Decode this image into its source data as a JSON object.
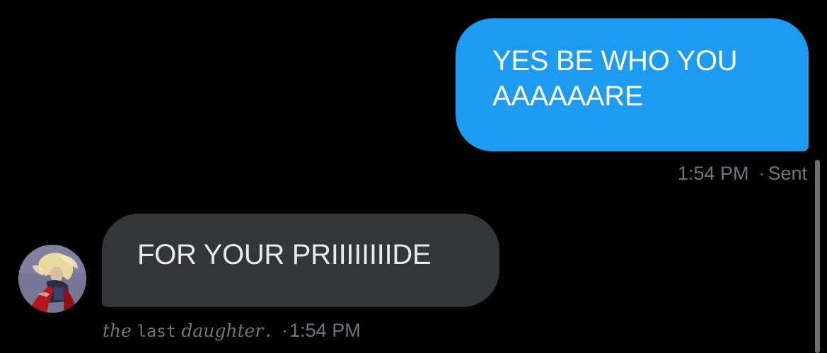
{
  "conversation": {
    "sent_message": {
      "text_line1": "YES BE WHO YOU",
      "text_line2": "AAAAAARE",
      "time": "1:54 PM",
      "separator": "·",
      "status": "Sent"
    },
    "received_message": {
      "text": "FOR YOUR PRIIIIIIIIDE",
      "sender_name": {
        "part1": "the",
        "part2": "last",
        "part3": "daughter",
        "part4": "."
      },
      "separator": "·",
      "time": "1:54 PM"
    }
  },
  "colors": {
    "background": "#000000",
    "sent_bubble": "#1d9bf0",
    "received_bubble": "#323639",
    "meta_text": "#71767b"
  }
}
